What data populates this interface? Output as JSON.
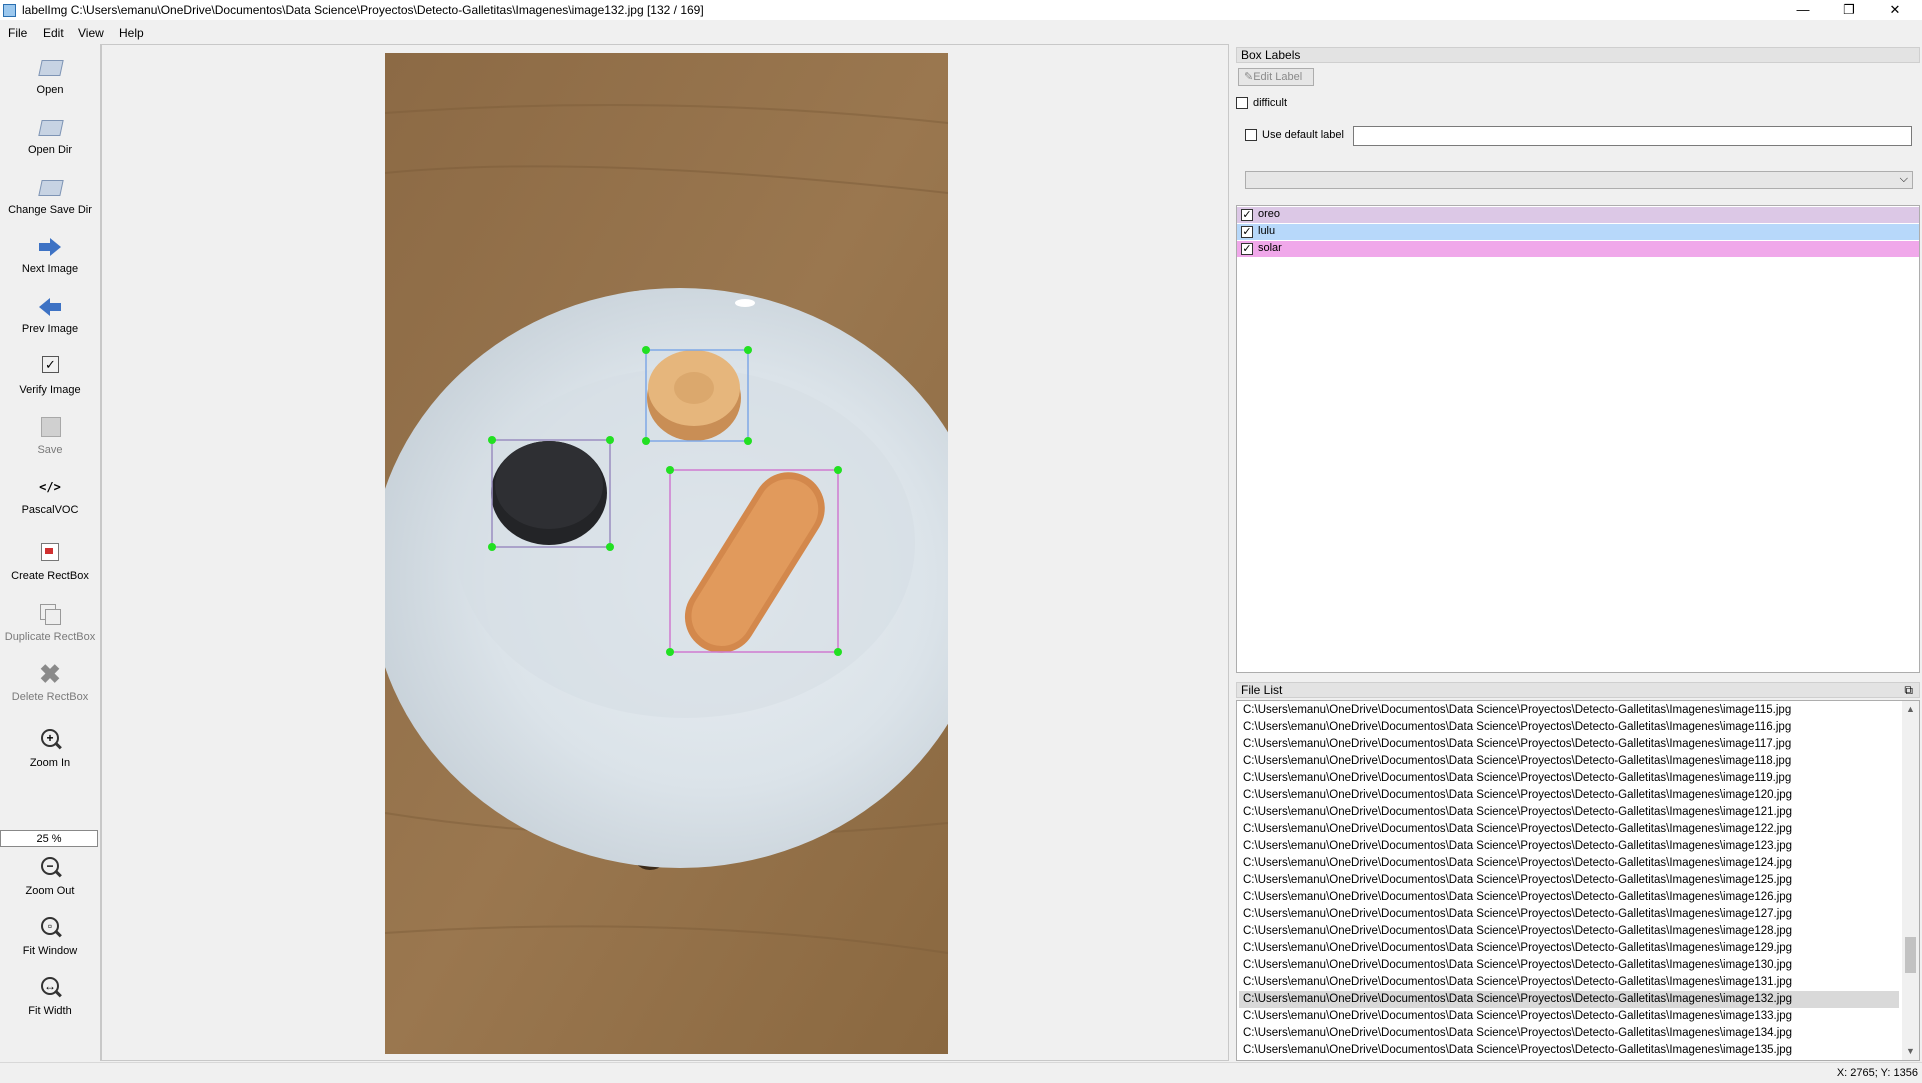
{
  "window": {
    "title": "labelImg C:\\Users\\emanu\\OneDrive\\Documentos\\Data Science\\Proyectos\\Detecto-Galletitas\\Imagenes\\image132.jpg [132 / 169]",
    "minimize": "—",
    "maximize": "❐",
    "close": "✕"
  },
  "menu": [
    "File",
    "Edit",
    "View",
    "Help"
  ],
  "toolbar": {
    "open": "Open",
    "open_dir": "Open Dir",
    "change_save_dir": "Change Save Dir",
    "next_image": "Next Image",
    "prev_image": "Prev Image",
    "verify_image": "Verify Image",
    "save": "Save",
    "format": "PascalVOC",
    "format_icon": "</>",
    "create_rectbox": "Create RectBox",
    "duplicate_rectbox": "Duplicate RectBox",
    "delete_rectbox": "Delete RectBox",
    "zoom_in": "Zoom In",
    "zoom_value": "25 %",
    "zoom_out": "Zoom Out",
    "fit_window": "Fit Window",
    "fit_width": "Fit Width"
  },
  "box_labels": {
    "title": "Box Labels",
    "edit_label": "Edit Label",
    "difficult": "difficult",
    "use_default_label": "Use default label",
    "default_label_value": "",
    "combo_value": "",
    "labels": [
      {
        "name": "oreo",
        "checked": true,
        "color": "#dcc8e6"
      },
      {
        "name": "lulu",
        "checked": true,
        "color": "#b7d8fa"
      },
      {
        "name": "solar",
        "checked": true,
        "color": "#f0a8ea"
      }
    ]
  },
  "file_list": {
    "title": "File List",
    "selected_index": 17,
    "files": [
      "C:\\Users\\emanu\\OneDrive\\Documentos\\Data Science\\Proyectos\\Detecto-Galletitas\\Imagenes\\image115.jpg",
      "C:\\Users\\emanu\\OneDrive\\Documentos\\Data Science\\Proyectos\\Detecto-Galletitas\\Imagenes\\image116.jpg",
      "C:\\Users\\emanu\\OneDrive\\Documentos\\Data Science\\Proyectos\\Detecto-Galletitas\\Imagenes\\image117.jpg",
      "C:\\Users\\emanu\\OneDrive\\Documentos\\Data Science\\Proyectos\\Detecto-Galletitas\\Imagenes\\image118.jpg",
      "C:\\Users\\emanu\\OneDrive\\Documentos\\Data Science\\Proyectos\\Detecto-Galletitas\\Imagenes\\image119.jpg",
      "C:\\Users\\emanu\\OneDrive\\Documentos\\Data Science\\Proyectos\\Detecto-Galletitas\\Imagenes\\image120.jpg",
      "C:\\Users\\emanu\\OneDrive\\Documentos\\Data Science\\Proyectos\\Detecto-Galletitas\\Imagenes\\image121.jpg",
      "C:\\Users\\emanu\\OneDrive\\Documentos\\Data Science\\Proyectos\\Detecto-Galletitas\\Imagenes\\image122.jpg",
      "C:\\Users\\emanu\\OneDrive\\Documentos\\Data Science\\Proyectos\\Detecto-Galletitas\\Imagenes\\image123.jpg",
      "C:\\Users\\emanu\\OneDrive\\Documentos\\Data Science\\Proyectos\\Detecto-Galletitas\\Imagenes\\image124.jpg",
      "C:\\Users\\emanu\\OneDrive\\Documentos\\Data Science\\Proyectos\\Detecto-Galletitas\\Imagenes\\image125.jpg",
      "C:\\Users\\emanu\\OneDrive\\Documentos\\Data Science\\Proyectos\\Detecto-Galletitas\\Imagenes\\image126.jpg",
      "C:\\Users\\emanu\\OneDrive\\Documentos\\Data Science\\Proyectos\\Detecto-Galletitas\\Imagenes\\image127.jpg",
      "C:\\Users\\emanu\\OneDrive\\Documentos\\Data Science\\Proyectos\\Detecto-Galletitas\\Imagenes\\image128.jpg",
      "C:\\Users\\emanu\\OneDrive\\Documentos\\Data Science\\Proyectos\\Detecto-Galletitas\\Imagenes\\image129.jpg",
      "C:\\Users\\emanu\\OneDrive\\Documentos\\Data Science\\Proyectos\\Detecto-Galletitas\\Imagenes\\image130.jpg",
      "C:\\Users\\emanu\\OneDrive\\Documentos\\Data Science\\Proyectos\\Detecto-Galletitas\\Imagenes\\image131.jpg",
      "C:\\Users\\emanu\\OneDrive\\Documentos\\Data Science\\Proyectos\\Detecto-Galletitas\\Imagenes\\image132.jpg",
      "C:\\Users\\emanu\\OneDrive\\Documentos\\Data Science\\Proyectos\\Detecto-Galletitas\\Imagenes\\image133.jpg",
      "C:\\Users\\emanu\\OneDrive\\Documentos\\Data Science\\Proyectos\\Detecto-Galletitas\\Imagenes\\image134.jpg",
      "C:\\Users\\emanu\\OneDrive\\Documentos\\Data Science\\Proyectos\\Detecto-Galletitas\\Imagenes\\image135.jpg"
    ]
  },
  "status": {
    "coordinates": "X: 2765; Y: 1356"
  },
  "colors": {
    "box_oreo": "#9a8ec0",
    "box_lulu": "#7fa8e6",
    "box_solar": "#d07ad0",
    "handle": "#22e022"
  }
}
